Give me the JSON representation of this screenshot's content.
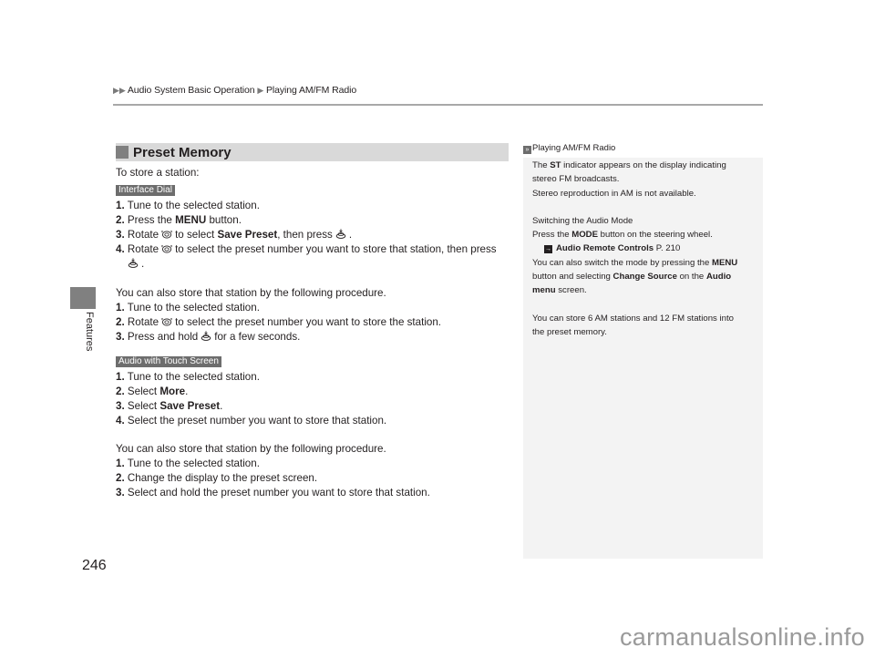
{
  "breadcrumb": {
    "items": [
      "Audio System Basic Operation",
      "Playing AM/FM Radio"
    ]
  },
  "side_tab": {
    "label": "Features"
  },
  "page_number": "246",
  "section": {
    "title": "Preset Memory",
    "intro": "To store a station:",
    "interface_dial": {
      "tag": "Interface Dial",
      "steps": [
        {
          "num": "1.",
          "text": "Tune to the selected station."
        },
        {
          "num": "2.",
          "pre": "Press the ",
          "bold": "MENU",
          "post": " button."
        },
        {
          "num": "3.",
          "pre": "Rotate",
          "mid": "to select ",
          "bold": "Save Preset",
          "post": ", then press",
          "end": "."
        },
        {
          "num": "4.",
          "pre": "Rotate",
          "post": "to select the preset number you want to store that station, then press",
          "end": "."
        }
      ],
      "alt_intro": "You can also store that station by the following procedure.",
      "alt_steps": [
        {
          "num": "1.",
          "text": "Tune to the selected station."
        },
        {
          "num": "2.",
          "pre": "Rotate",
          "post": "to select the preset number you want to store the station."
        },
        {
          "num": "3.",
          "pre": "Press and hold",
          "post": "for a few seconds."
        }
      ]
    },
    "touch_screen": {
      "tag": "Audio with Touch Screen",
      "steps": [
        {
          "num": "1.",
          "text": "Tune to the selected station."
        },
        {
          "num": "2.",
          "pre": "Select ",
          "bold": "More",
          "post": "."
        },
        {
          "num": "3.",
          "pre": "Select ",
          "bold": "Save Preset",
          "post": "."
        },
        {
          "num": "4.",
          "text": "Select the preset number you want to store that station."
        }
      ],
      "alt_intro": "You can also store that station by the following procedure.",
      "alt_steps": [
        {
          "num": "1.",
          "text": "Tune to the selected station."
        },
        {
          "num": "2.",
          "text": "Change the display to the preset screen."
        },
        {
          "num": "3.",
          "text": "Select and hold the preset number you want to store that station."
        }
      ]
    }
  },
  "aside": {
    "ref_title": "Playing AM/FM Radio",
    "p1": {
      "pre": "The ",
      "bold": "ST",
      "post": " indicator appears on the display indicating"
    },
    "p1b": "stereo FM broadcasts.",
    "p1c": "Stereo reproduction in AM is not available.",
    "p2_title": "Switching the Audio Mode",
    "p2": {
      "pre": "Press the ",
      "bold": "MODE",
      "post": " button on the steering wheel."
    },
    "xref": {
      "bold": "Audio Remote Controls",
      "page": " P. 210"
    },
    "p3": {
      "l1_pre": "You can also switch the mode by pressing the ",
      "l1_bold": "MENU",
      "l2_pre": "button and selecting ",
      "l2_bold": "Change Source",
      "l2_mid": " on the ",
      "l2_bold2": "Audio",
      "l3_bold": "menu",
      "l3_post": " screen."
    },
    "p4a": "You can store 6 AM stations and 12 FM stations into",
    "p4b": "the preset memory."
  },
  "watermark": "carmanualsonline.info"
}
